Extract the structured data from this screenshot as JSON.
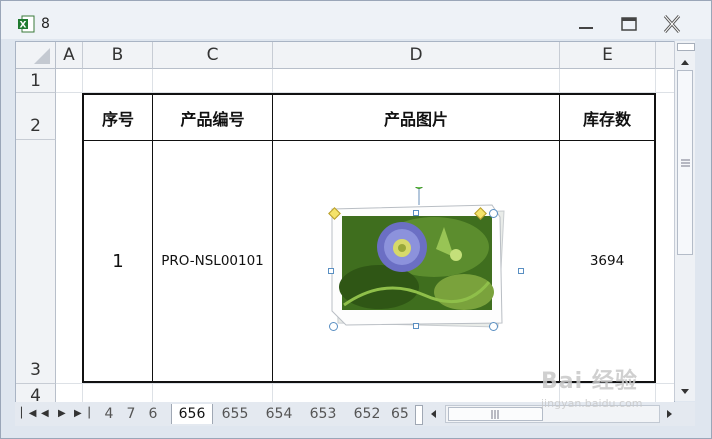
{
  "window": {
    "title": "8"
  },
  "columns": [
    "A",
    "B",
    "C",
    "D",
    "E"
  ],
  "rows": [
    "1",
    "2",
    "3",
    "4"
  ],
  "table": {
    "headers": [
      "序号",
      "产品编号",
      "产品图片",
      "库存数"
    ],
    "row": {
      "index": "1",
      "code": "PRO-NSL00101",
      "stock": "3694"
    }
  },
  "sheet_tabs": [
    "4",
    "7",
    "6",
    "656",
    "655",
    "654",
    "653",
    "652",
    "65"
  ],
  "active_tab": "656",
  "watermark": {
    "logo": "Bai 经验",
    "url": "jingyan.baidu.com"
  }
}
